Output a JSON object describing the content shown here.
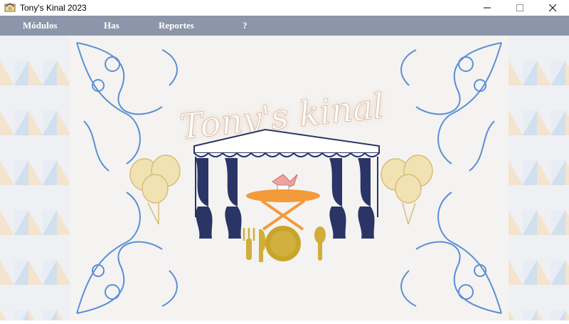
{
  "window": {
    "title": "Tony's Kinal 2023",
    "icon": "app-icon"
  },
  "menubar": {
    "items": [
      "Módulos",
      "Has",
      "Reportes",
      "?"
    ]
  },
  "banner": {
    "logo_text": "Tony's kinal"
  },
  "colors": {
    "menubar_bg": "#8c96aa",
    "ornament_blue": "#5b8fd4",
    "tent_navy": "#2a3566",
    "balloon_gold": "#e3cb8c",
    "table_orange": "#f39a3a",
    "cutlery_gold": "#d2ad3a"
  }
}
